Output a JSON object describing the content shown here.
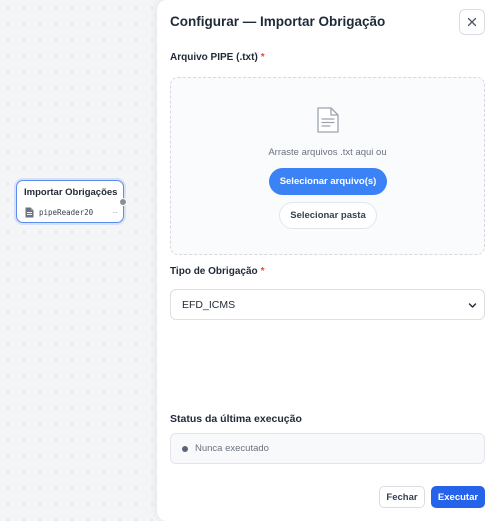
{
  "canvas": {
    "node": {
      "title": "Importar Obrigações",
      "subtitle": "pipeReader20",
      "more": "···",
      "icon": "file-icon"
    }
  },
  "panel": {
    "title": "Configurar — Importar Obrigação",
    "close_icon": "close-icon",
    "file_field": {
      "label": "Arquivo PIPE (.txt)",
      "required_mark": "*",
      "drop_text": "Arraste arquivos .txt aqui ou",
      "select_files_label": "Selecionar arquivo(s)",
      "select_folder_label": "Selecionar pasta",
      "icon": "document-icon"
    },
    "type_field": {
      "label": "Tipo de Obrigação",
      "required_mark": "*",
      "selected": "EFD_ICMS"
    },
    "status": {
      "label": "Status da última execução",
      "text": "Nunca executado"
    },
    "footer": {
      "close_label": "Fechar",
      "run_label": "Executar"
    }
  },
  "colors": {
    "accent": "#3b82f6",
    "run_button": "#2563eb",
    "required": "#ef4444",
    "node_border": "#5b8def"
  }
}
